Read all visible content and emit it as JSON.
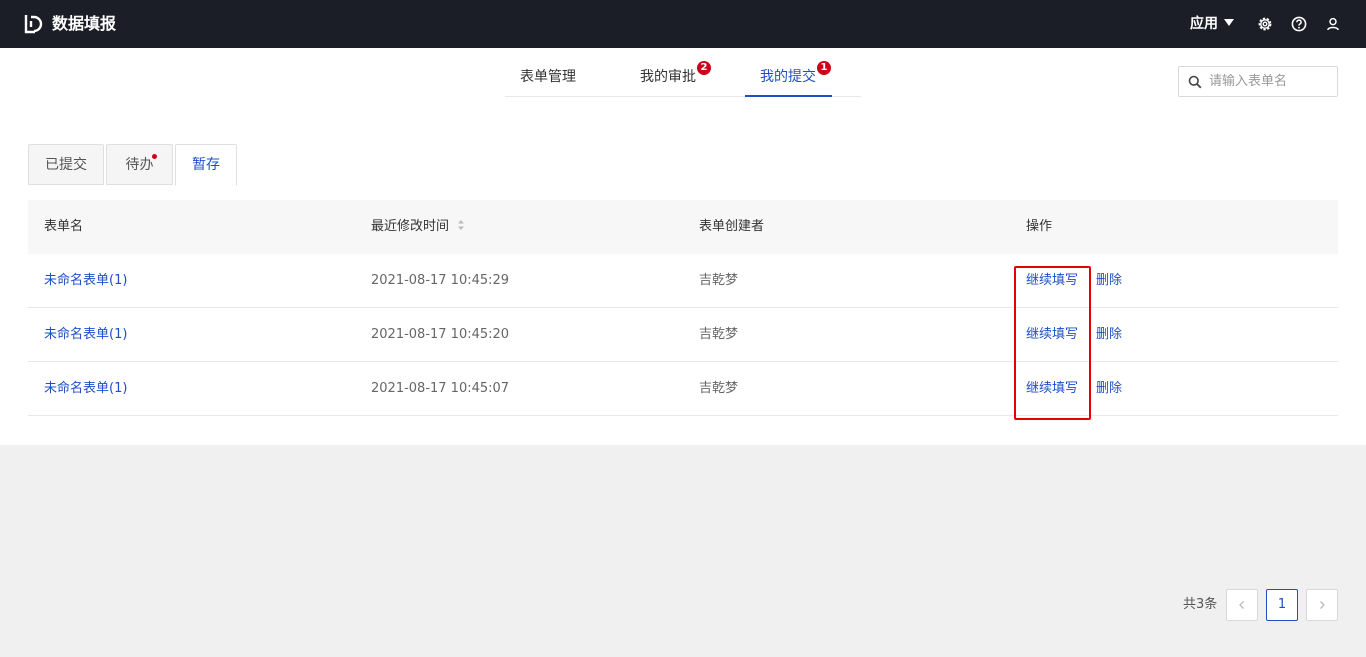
{
  "header": {
    "title": "数据填报",
    "apps_label": "应用",
    "icons": [
      "logo-icon",
      "gear-icon",
      "help-icon",
      "user-icon"
    ]
  },
  "nav": {
    "tabs": [
      {
        "label": "表单管理",
        "badge": null
      },
      {
        "label": "我的审批",
        "badge": "2"
      },
      {
        "label": "我的提交",
        "badge": "1"
      }
    ],
    "active_tab": "我的提交",
    "search_placeholder": "请输入表单名"
  },
  "sub_tabs": {
    "items": [
      "已提交",
      "待办",
      "暂存"
    ],
    "active": "暂存"
  },
  "table": {
    "columns": [
      "表单名",
      "最近修改时间",
      "表单创建者",
      "操作"
    ],
    "rows": [
      {
        "name": "未命名表单(1)",
        "modified": "2021-08-17 10:45:29",
        "creator": "吉乾梦",
        "continue": "继续填写",
        "delete": "删除"
      },
      {
        "name": "未命名表单(1)",
        "modified": "2021-08-17 10:45:20",
        "creator": "吉乾梦",
        "continue": "继续填写",
        "delete": "删除"
      },
      {
        "name": "未命名表单(1)",
        "modified": "2021-08-17 10:45:07",
        "creator": "吉乾梦",
        "continue": "继续填写",
        "delete": "删除"
      }
    ]
  },
  "pagination": {
    "total_label": "共3条",
    "current_page": "1"
  },
  "colors": {
    "accent": "#1f4fc7",
    "topbar": "#1b1e26",
    "badge": "#d0021b",
    "highlight": "#e60000"
  }
}
